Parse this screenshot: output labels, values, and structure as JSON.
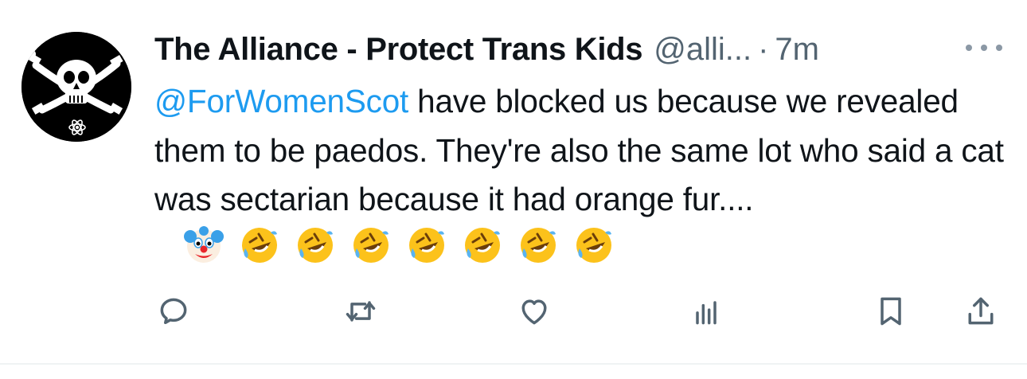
{
  "tweet": {
    "author": {
      "display_name": "The Alliance - Protect Trans Kids",
      "handle": "@alli...",
      "separator": "·",
      "time": "7m",
      "avatar_icon": "pirate-skull-avatar"
    },
    "text": {
      "mention": "@ForWomenScot",
      "body": " have blocked us because we revealed them to be paedos.  They're also the same lot who said a cat was sectarian because it had orange fur...."
    },
    "emojis": [
      "clown-face-emoji",
      "rolling-on-floor-laughing-emoji",
      "rolling-on-floor-laughing-emoji",
      "rolling-on-floor-laughing-emoji",
      "rolling-on-floor-laughing-emoji",
      "rolling-on-floor-laughing-emoji",
      "rolling-on-floor-laughing-emoji",
      "rolling-on-floor-laughing-emoji"
    ],
    "actions": {
      "reply_icon": "reply-icon",
      "retweet_icon": "retweet-icon",
      "like_icon": "heart-icon",
      "views_icon": "analytics-icon",
      "bookmark_icon": "bookmark-icon",
      "share_icon": "share-icon"
    },
    "colors": {
      "text": "#0f1419",
      "secondary": "#536471",
      "link": "#1d9bf0",
      "icon": "#536471"
    }
  }
}
